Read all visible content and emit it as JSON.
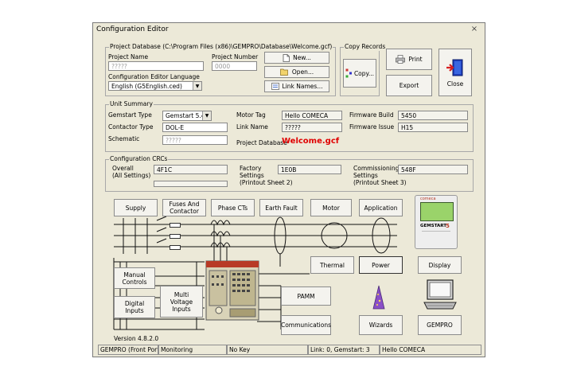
{
  "window": {
    "title": "Configuration Editor",
    "close_glyph": "×"
  },
  "project_db": {
    "group_label": "Project Database (C:\\Program Files (x86)\\GEMPRO\\Database\\Welcome.gcf)",
    "project_name_label": "Project Name",
    "project_name_value": "?????",
    "project_number_label": "Project Number",
    "project_number_value": "0000",
    "language_label": "Configuration Editor Language",
    "language_value": "English    (G5English.ced)",
    "new_label": "New...",
    "open_label": "Open...",
    "link_names_label": "Link Names..."
  },
  "copy_records": {
    "group_label": "Copy Records",
    "copy_label": "Copy..."
  },
  "toolbar": {
    "print_label": "Print",
    "export_label": "Export",
    "close_label": "Close"
  },
  "unit_summary": {
    "group_label": "Unit Summary",
    "gemstart_type_label": "Gemstart Type",
    "gemstart_type_value": "Gemstart 5.4",
    "contactor_type_label": "Contactor Type",
    "contactor_type_value": "DOL-E",
    "schematic_label": "Schematic",
    "schematic_value": "?????",
    "motor_tag_label": "Motor Tag",
    "motor_tag_value": "Hello COMECA",
    "link_name_label": "Link Name",
    "link_name_value": "?????",
    "project_database_label": "Project Database",
    "project_database_value": "Welcome.gcf",
    "firmware_build_label": "Firmware Build",
    "firmware_build_value": "5450",
    "firmware_issue_label": "Firmware Issue",
    "firmware_issue_value": "H15"
  },
  "crcs": {
    "group_label": "Configuration CRCs",
    "overall_label_1": "Overall",
    "overall_label_2": "(All Settings)",
    "overall_value": "4F1C",
    "factory_label_1": "Factory",
    "factory_label_2": "Settings",
    "factory_label_3": "(Printout Sheet 2)",
    "factory_value": "1E0B",
    "commissioning_label_1": "Commissioning",
    "commissioning_label_2": "Settings",
    "commissioning_label_3": "(Printout Sheet 3)",
    "commissioning_value": "548F"
  },
  "diagram": {
    "supply": "Supply",
    "fuses_1": "Fuses And",
    "fuses_2": "Contactor",
    "phase_cts": "Phase CTs",
    "earth_fault": "Earth Fault",
    "motor": "Motor",
    "application": "Application",
    "thermal": "Thermal",
    "power": "Power",
    "display": "Display",
    "manual_1": "Manual",
    "manual_2": "Controls",
    "digital_1": "Digital",
    "digital_2": "Inputs",
    "multi_1": "Multi",
    "multi_2": "Voltage",
    "multi_3": "Inputs",
    "pamm": "PAMM",
    "communications": "Communications",
    "wizards": "Wizards",
    "gempro": "GEMPRO",
    "device_brand": "comeca",
    "device_model": "GEMSTART",
    "device_model_num": "5"
  },
  "version": "Version 4.8.2.0",
  "statusbar": {
    "port": "GEMPRO (Front Port)",
    "mode": "Monitoring",
    "key": "No Key",
    "link": "Link: 0, Gemstart: 3",
    "tag": "Hello COMECA"
  },
  "colors": {
    "accent_red": "#e00000",
    "face": "#ece9d8",
    "lcd_green": "#9ad36a"
  }
}
